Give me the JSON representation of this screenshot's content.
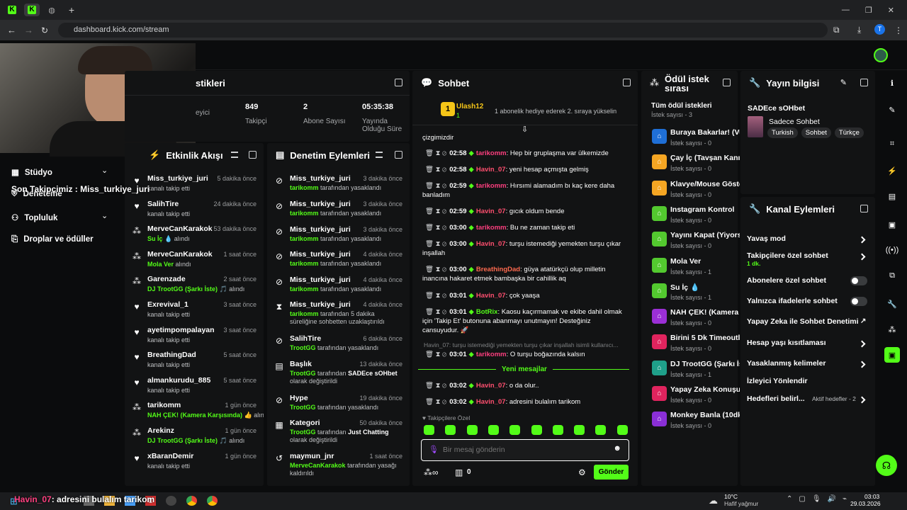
{
  "browser": {
    "url": "dashboard.kick.com/stream"
  },
  "overlay": {
    "last_follower": "Son Takipçimiz : Miss_turkiye_juri"
  },
  "sidebar": {
    "items": [
      {
        "label": "Stüdyo"
      },
      {
        "label": "Deneteme"
      },
      {
        "label": "Topluluk"
      },
      {
        "label": "Droplar ve ödüller"
      }
    ]
  },
  "stats": {
    "title": "stikleri",
    "items": [
      {
        "value": "",
        "label": "eyici"
      },
      {
        "value": "849",
        "label": "Takipçi"
      },
      {
        "value": "2",
        "label": "Abone Sayısı"
      },
      {
        "value": "05:35:38",
        "label": "Yayında Olduğu Süre"
      }
    ]
  },
  "activity": {
    "title": "Etkinlik Akışı",
    "rows": [
      {
        "icon": "heart",
        "name": "Miss_turkiye_juri",
        "time": "5 dakika önce",
        "sub": "kanalı takip etti"
      },
      {
        "icon": "heart",
        "name": "SalihTire",
        "time": "24 dakika önce",
        "sub": "kanalı takip etti"
      },
      {
        "icon": "redeem",
        "name": "MerveCanKarakok",
        "time": "53 dakika önce",
        "sub_green": "Su İç 💧",
        "sub": "alındı"
      },
      {
        "icon": "redeem",
        "name": "MerveCanKarakok",
        "time": "1 saat önce",
        "sub_green": "Mola Ver",
        "sub": "alındı"
      },
      {
        "icon": "redeem",
        "name": "Garenzade",
        "time": "2 saat önce",
        "sub_green": "DJ TrootGG (Şarkı İste) 🎵",
        "sub": "alındı"
      },
      {
        "icon": "heart",
        "name": "Exrevival_1",
        "time": "3 saat önce",
        "sub": "kanalı takip etti"
      },
      {
        "icon": "heart",
        "name": "ayetimpompalayan",
        "time": "3 saat önce",
        "sub": "kanalı takip etti"
      },
      {
        "icon": "heart",
        "name": "BreathingDad",
        "time": "5 saat önce",
        "sub": "kanalı takip etti"
      },
      {
        "icon": "heart",
        "name": "almankurudu_885",
        "time": "5 saat önce",
        "sub": "kanalı takip etti"
      },
      {
        "icon": "redeem",
        "name": "tarikomm",
        "time": "1 gün önce",
        "sub_green": "NAH ÇEK! (Kamera Karşısında) 👍",
        "sub": "alındı"
      },
      {
        "icon": "redeem",
        "name": "Arekinz",
        "time": "1 gün önce",
        "sub_green": "DJ TrootGG (Şarkı İste) 🎵",
        "sub": "alındı"
      },
      {
        "icon": "heart",
        "name": "xBaranDemir",
        "time": "1 gün önce",
        "sub": "kanalı takip etti"
      }
    ]
  },
  "moderation": {
    "title": "Denetim Eylemleri",
    "rows": [
      {
        "icon": "ban",
        "name": "Miss_turkiye_juri",
        "time": "3 dakika önce",
        "actor": "tarikomm",
        "sub": "tarafından yasaklandı"
      },
      {
        "icon": "ban",
        "name": "Miss_turkiye_juri",
        "time": "3 dakika önce",
        "actor": "tarikomm",
        "sub": "tarafından yasaklandı"
      },
      {
        "icon": "ban",
        "name": "Miss_turkiye_juri",
        "time": "3 dakika önce",
        "actor": "tarikomm",
        "sub": "tarafından yasaklandı"
      },
      {
        "icon": "ban",
        "name": "Miss_turkiye_juri",
        "time": "4 dakika önce",
        "actor": "tarikomm",
        "sub": "tarafından yasaklandı"
      },
      {
        "icon": "ban",
        "name": "Miss_turkiye_juri",
        "time": "4 dakika önce",
        "actor": "tarikomm",
        "sub": "tarafından yasaklandı"
      },
      {
        "icon": "timeout",
        "name": "Miss_turkiye_juri",
        "time": "4 dakika önce",
        "actor": "tarikomm",
        "sub": "tarafından 5 dakika süreliğine sohbetten uzaklaştırıldı"
      },
      {
        "icon": "ban",
        "name": "SalihTire",
        "time": "6 dakika önce",
        "actor": "TrootGG",
        "sub": "tarafından yasaklandı"
      },
      {
        "icon": "title",
        "name": "Başlık",
        "time": "13 dakika önce",
        "actor": "TrootGG",
        "sub": "tarafından",
        "extra": "SADEce sOHbet",
        "sub2": "olarak değiştirildi"
      },
      {
        "icon": "ban",
        "name": "Hype",
        "time": "19 dakika önce",
        "actor": "TrootGG",
        "sub": "tarafından yasaklandı"
      },
      {
        "icon": "category",
        "name": "Kategori",
        "time": "50 dakika önce",
        "actor": "TrootGG",
        "sub": "tarafından",
        "extra": "Just Chatting",
        "sub2": "olarak değiştirildi"
      },
      {
        "icon": "undo",
        "name": "maymun_jnr",
        "time": "1 saat önce",
        "actor": "MerveCanKarakok",
        "sub": "tarafından yasağı kaldırıldı"
      }
    ]
  },
  "chat": {
    "title": "Sohbet",
    "pinned_user": "Ulash12",
    "pinned_count": "1",
    "pinned_text": "1 abonelik hediye ederek 2. sıraya yükselin",
    "top_fragment": "çizgimizdir",
    "messages": [
      {
        "time": "02:58",
        "user": "tarikomm",
        "color": "#ff3f7f",
        "text": "Hep bir gruplaşma var ülkemizde"
      },
      {
        "time": "02:58",
        "user": "Havin_07",
        "color": "#ff4f6f",
        "text": "yeni hesap açmışta gelmiş"
      },
      {
        "time": "02:59",
        "user": "tarikomm",
        "color": "#ff3f7f",
        "text": "Hırsımi alamadım bı kaç kere daha banladım"
      },
      {
        "time": "02:59",
        "user": "Havin_07",
        "color": "#ff4f6f",
        "text": "gıcık oldum bende"
      },
      {
        "time": "03:00",
        "user": "tarikomm",
        "color": "#ff3f7f",
        "text": "Bu ne zaman takip eti"
      },
      {
        "time": "03:00",
        "user": "Havin_07",
        "color": "#ff4f6f",
        "text": "turşu istemediği yemekten turşu çıkar inşallah"
      },
      {
        "time": "03:00",
        "user": "BreathingDad",
        "color": "#ff6a4f",
        "text": "güya atatürkçü olup milletin inancına hakaret etmek bambaşka bir cahillik aq"
      },
      {
        "time": "03:01",
        "user": "Havin_07",
        "color": "#ff4f6f",
        "text": "çok yaaşa"
      },
      {
        "time": "03:01",
        "user": "BotRix",
        "color": "#53fc18",
        "text": "Kaosu kaçırmamak ve ekibe dahil olmak için 'Takip Et' butonuna abanmayı unutmayın! Desteğiniz cansuyudur. 🚀"
      }
    ],
    "reply_ref": "Havin_07: turşu istemediği yemekten turşu çıkar inşallah isimli kullanıcı...",
    "reply_msg": {
      "time": "03:01",
      "user": "tarikomm",
      "color": "#ff3f7f",
      "text": "O turşu boğazında kalsın"
    },
    "new_messages_label": "Yeni mesajlar",
    "new_messages": [
      {
        "time": "03:02",
        "user": "Havin_07",
        "color": "#ff4f6f",
        "text": "o da olur.."
      },
      {
        "time": "03:02",
        "user": "Havin_07",
        "color": "#ff4f6f",
        "text": "adresini bulalım tarikom"
      }
    ],
    "mode_label": "Takipçilere Özel",
    "input_placeholder": "Bir mesaj gönderin",
    "points": "0",
    "send_label": "Gönder"
  },
  "rewards": {
    "title": "Ödül istek sırası",
    "subtitle": "Tüm ödül istekleri",
    "count": "İstek sayısı - 3",
    "items": [
      {
        "name": "Buraya Bakarlar! (Vu...",
        "count": "İstek sayısı - 0",
        "color": "#1f6fd6"
      },
      {
        "name": "Çay İç (Tavşan Kanı).",
        "count": "İstek sayısı - 0",
        "color": "#f5a623"
      },
      {
        "name": "Klavye/Mouse Göster",
        "count": "İstek sayısı - 0",
        "color": "#f5a623"
      },
      {
        "name": "Instagram Kontrol",
        "count": "İstek sayısı - 0",
        "color": "#53c92f"
      },
      {
        "name": "Yayını Kapat (Yiyors...",
        "count": "İstek sayısı - 0",
        "color": "#53c92f"
      },
      {
        "name": "Mola Ver",
        "count": "İstek sayısı - 1",
        "color": "#53c92f"
      },
      {
        "name": "Su İç 💧",
        "count": "İstek sayısı - 1",
        "color": "#53c92f"
      },
      {
        "name": "NAH ÇEK! (Kamera ...",
        "count": "İstek sayısı - 0",
        "color": "#9b2fd6"
      },
      {
        "name": "Birini 5 Dk Timeoutla...",
        "count": "İstek sayısı - 0",
        "color": "#e0245e"
      },
      {
        "name": "DJ TrootGG (Şarkı İs...",
        "count": "İstek sayısı - 1",
        "color": "#1fa08a"
      },
      {
        "name": "Yapay Zeka Konuşu...",
        "count": "İstek sayısı - 0",
        "color": "#e0245e"
      },
      {
        "name": "Monkey Banla (10dk)",
        "count": "İstek sayısı - 0",
        "color": "#8a2fd6"
      }
    ]
  },
  "stream_info": {
    "title": "Yayın bilgisi",
    "stream_title": "SADEce sOHbet",
    "category": "Sadece Sohbet",
    "tags": [
      "Turkish",
      "Sohbet",
      "Türkçe"
    ]
  },
  "channel_actions": {
    "title": "Kanal Eylemleri",
    "items": [
      {
        "label": "Yavaş mod",
        "control": "chevron"
      },
      {
        "label": "Takipçilere özel sohbet",
        "sub": "1 dk.",
        "control": "chevron"
      },
      {
        "label": "Abonelere özel sohbet",
        "control": "toggle"
      },
      {
        "label": "Yalnızca ifadelerle sohbet",
        "control": "toggle"
      },
      {
        "label": "Yapay Zeka ile Sohbet Denetimi",
        "control": "external"
      },
      {
        "label": "Hesap yaşı kısıtlaması",
        "control": "chevron"
      },
      {
        "label": "Yasaklanmış kelimeler",
        "control": "chevron"
      },
      {
        "label": "İzleyici Yönlendir",
        "control": "none"
      },
      {
        "label": "Hedefleri belirl...",
        "sub": "Aktif hedefler - 2",
        "control": "chevron"
      }
    ]
  },
  "taskbar": {
    "caption_user": "Havin_07",
    "caption_text": ": adresini bulalım tarikom",
    "weather_temp": "10°C",
    "weather_desc": "Hafif yağmur",
    "time": "03:03",
    "date": "29.03.2026"
  },
  "colors": {
    "accent": "#53fc18",
    "panel": "#121314",
    "bg": "#0b0c0d"
  }
}
